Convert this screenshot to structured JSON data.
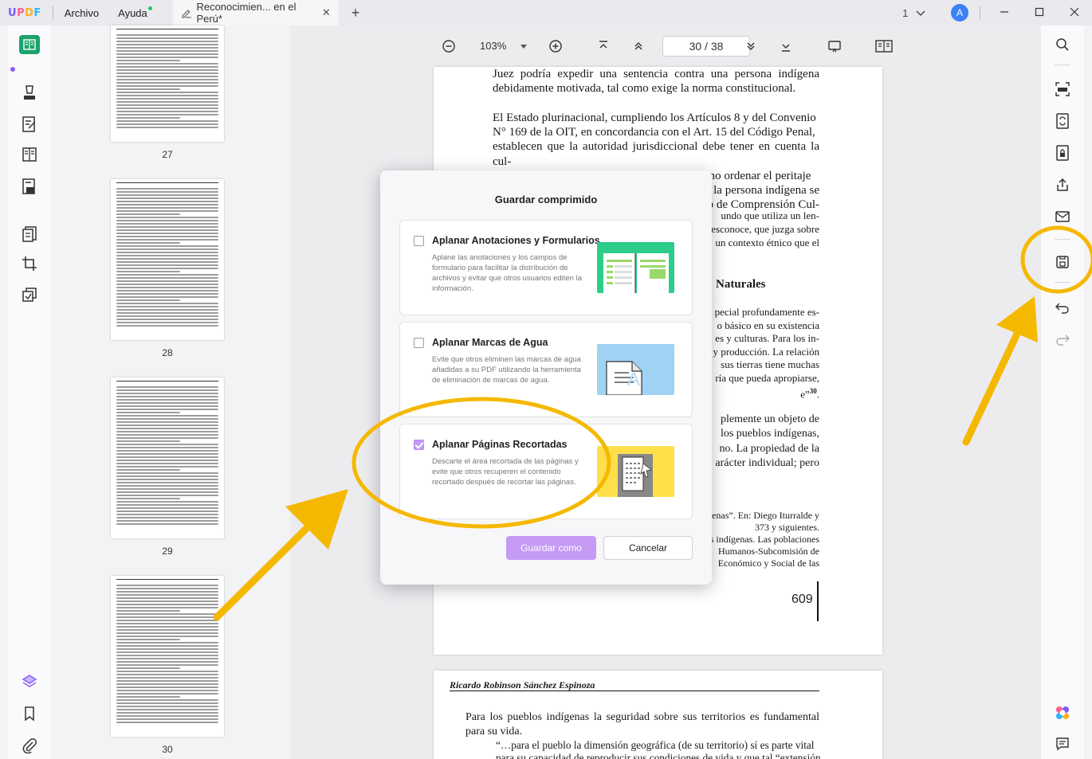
{
  "titlebar": {
    "menu_archivo": "Archivo",
    "menu_ayuda": "Ayuda",
    "tab_title": "Reconocimien... en el Perú*",
    "tab_close": "✕",
    "new_tab": "+",
    "page_count_label": "1",
    "avatar_letter": "A"
  },
  "logo": {
    "u": "U",
    "p": "P",
    "d": "D",
    "f": "F"
  },
  "thumbnails": [
    {
      "label": "27"
    },
    {
      "label": "28"
    },
    {
      "label": "29"
    },
    {
      "label": "30"
    }
  ],
  "viewer": {
    "zoom": "103%",
    "current_page": "30",
    "total_pages": "38",
    "page_separator": "/"
  },
  "page30": {
    "para1": "Juez podría expedir una sentencia contra una persona indígena debidamente motivada, tal como exige la norma constitucional.",
    "para2_lines": [
      "El Estado plurinacional, cumpliendo los Artículos 8 y del Convenio",
      "N° 169 de la OIT, en concordancia con el Art. 15 del Código Penal,",
      "establecen que la autoridad jurisdiccional debe tener en cuenta la cul-",
      "tura y la costumbre de los procesados; así como ordenar el peritaje",
      "la persona indígena se",
      "o de Comprensión Cul-"
    ],
    "right_fragments": [
      "undo que utiliza un len-",
      "esconoce, que juzga sobre",
      "un contexto étnico que el"
    ],
    "heading_fragment": "Naturales",
    "right_fragments2": [
      "pecial profundamente es-",
      "o básico en su existencia",
      "es y culturas. Para los in-",
      "y producción. La relación",
      "sus tierras tiene muchas",
      "ría que pueda apropiarse,",
      "e”"
    ],
    "footnote_sup": "30",
    "right_fragments3": [
      "plemente un objeto de",
      "los pueblos indígenas,",
      "no. La propiedad de la",
      "arácter individual; pero"
    ],
    "footnotes": [
      "enas”. En: Diego Iturralde y",
      "373 y siguientes.",
      "s indígenas. Las poblaciones",
      "Humanos-Subcomisión de",
      "Económico y Social de las"
    ],
    "page_number": "609"
  },
  "page31": {
    "header": "Ricardo Robinson Sánchez Espinoza",
    "para1": "Para los pueblos indígenas la seguridad sobre sus territorios es fundamental para su vida.",
    "quote_lines": [
      "“…para el pueblo la dimensión geográfica (de su territorio) sí es parte vital",
      "para su capacidad de reproducir sus condiciones de vida y que tal “extensión"
    ]
  },
  "dialog": {
    "title": "Guardar comprimido",
    "options": [
      {
        "title": "Aplanar Anotaciones y Formularios",
        "desc": "Aplane las anotaciones y los campos de formulario para facilitar la distribución de archivos y evitar que otros usuarios editen la información.",
        "checked": false
      },
      {
        "title": "Aplanar Marcas de Agua",
        "desc": "Evite que otros eliminen las marcas de agua añadidas a su PDF utilizando la herramienta de eliminación de marcas de agua.",
        "checked": false
      },
      {
        "title": "Aplanar Páginas Recortadas",
        "desc": "Descarte el área recortada de las páginas y evite que otros recuperen el contenido recortado después de recortar las páginas.",
        "checked": true
      }
    ],
    "save_as": "Guardar como",
    "cancel": "Cancelar"
  },
  "icons": {
    "left": [
      "reader-icon",
      "comment-icon",
      "edit-pdf-icon",
      "page-organize-icon",
      "form-icon",
      "convert-icon",
      "crop-icon",
      "page-tools-icon",
      "layers-icon",
      "bookmark-icon",
      "attachment-icon"
    ],
    "right": [
      "search-icon",
      "ocr-icon",
      "convert-pdf-icon",
      "protect-icon",
      "share-icon",
      "email-icon",
      "save-compressed-icon",
      "undo-icon",
      "redo-icon",
      "ai-assistant-icon",
      "chat-icon"
    ]
  },
  "colors": {
    "accent": "#8b5cf6",
    "primary_button": "#c59bf5",
    "annotation_yellow": "#f5b800",
    "avatar": "#3b82f6"
  }
}
